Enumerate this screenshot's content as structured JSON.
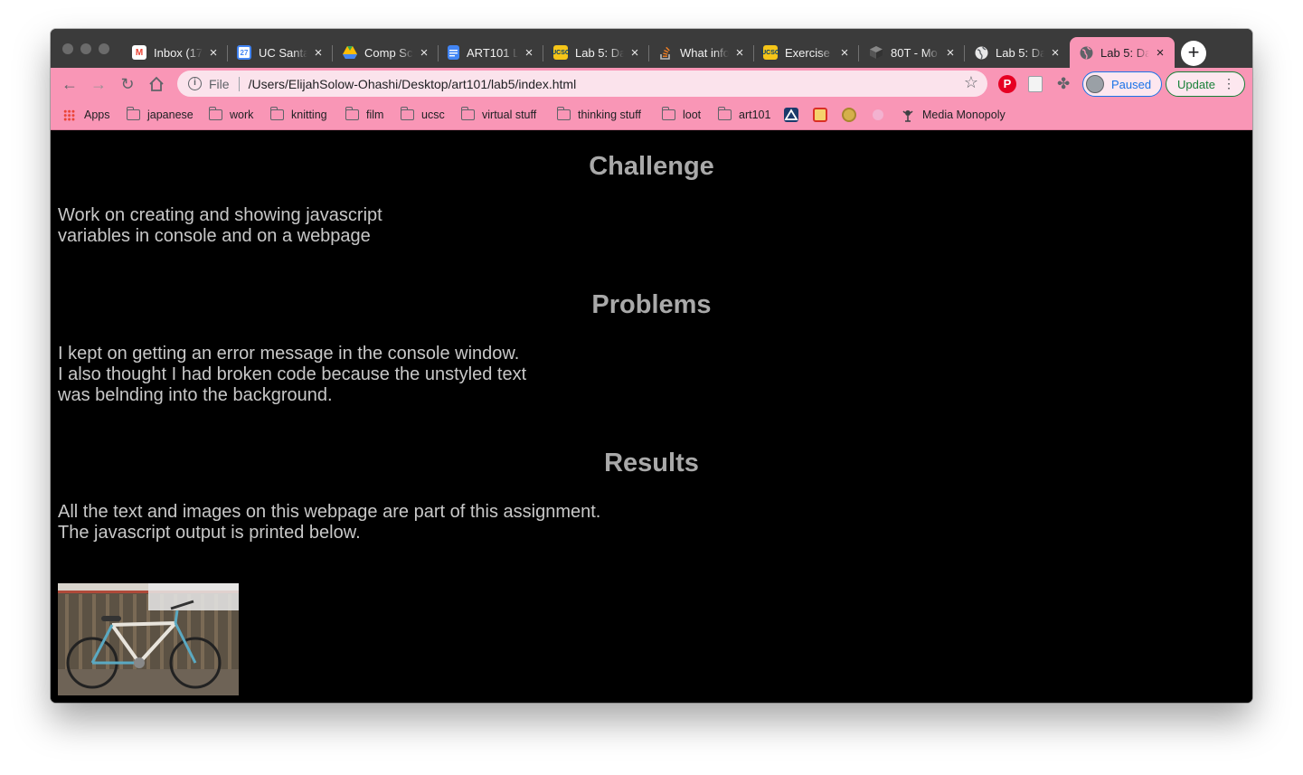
{
  "browser": {
    "tabs": [
      {
        "title": "Inbox (17",
        "favicon": "gmail-icon"
      },
      {
        "title": "UC Santa",
        "favicon": "calendar-icon"
      },
      {
        "title": "Comp Sc",
        "favicon": "drive-icon"
      },
      {
        "title": "ART101 L",
        "favicon": "docs-icon"
      },
      {
        "title": "Lab 5: Da",
        "favicon": "ucsc-icon"
      },
      {
        "title": "What info",
        "favicon": "stackoverflow-icon"
      },
      {
        "title": "Exercise",
        "favicon": "ucsc-icon"
      },
      {
        "title": "80T - Mo",
        "favicon": "cube-icon"
      },
      {
        "title": "Lab 5: Da",
        "favicon": "globe-icon"
      },
      {
        "title": "Lab 5: Da",
        "favicon": "globe-icon",
        "active": true
      }
    ],
    "url_scheme": "File",
    "url": "/Users/ElijahSolow-Ohashi/Desktop/art101/lab5/index.html",
    "profile_label": "Paused",
    "update_label": "Update",
    "theme_color": "#f996b6"
  },
  "bookmarks": [
    {
      "label": "Apps",
      "icon": "apps-grid-icon"
    },
    {
      "label": "japanese",
      "icon": "folder-icon"
    },
    {
      "label": "work",
      "icon": "folder-icon"
    },
    {
      "label": "knitting",
      "icon": "folder-icon"
    },
    {
      "label": "film",
      "icon": "folder-icon"
    },
    {
      "label": "ucsc",
      "icon": "folder-icon"
    },
    {
      "label": "virtual stuff",
      "icon": "folder-icon"
    },
    {
      "label": "thinking stuff",
      "icon": "folder-icon"
    },
    {
      "label": "loot",
      "icon": "folder-icon"
    },
    {
      "label": "art101",
      "icon": "folder-icon"
    },
    {
      "label": "Media Monopoly",
      "icon": "media-monopoly-icon"
    }
  ],
  "content": {
    "challenge": {
      "heading": "Challenge",
      "line1": "Work on creating and showing javascript",
      "line2": "variables in console and on a webpage"
    },
    "problems": {
      "heading": "Problems",
      "line1": "I kept on getting an error message in the console window.",
      "line2": "I also thought I had broken code because the unstyled text",
      "line3": "was belnding into the background."
    },
    "results": {
      "heading": "Results",
      "line1": "All the text and images on this webpage are part of this assignment.",
      "line2": "The javascript output is printed below."
    },
    "image_alt": "bicycle photo"
  }
}
